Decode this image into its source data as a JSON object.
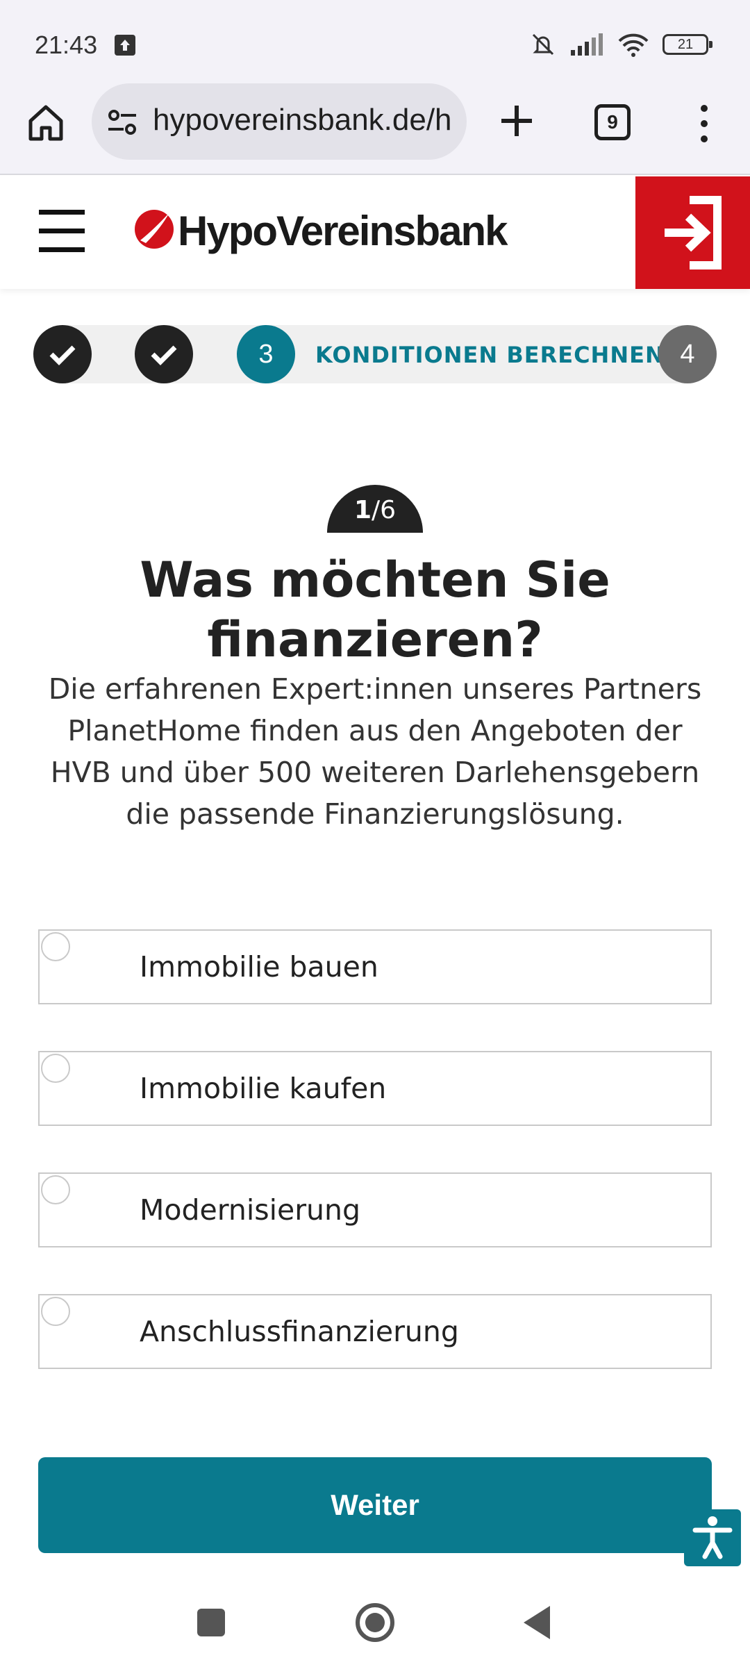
{
  "status_bar": {
    "time": "21:43",
    "battery": "21",
    "icons": [
      "upload-icon",
      "mute-icon",
      "signal-icon",
      "wifi-icon",
      "battery-icon"
    ]
  },
  "browser": {
    "url": "hypovereinsbank.de/h",
    "tab_count": "9"
  },
  "header": {
    "brand": "HypoVereinsbank",
    "brand_color": "#d1121b"
  },
  "stepper": {
    "steps": [
      {
        "state": "done"
      },
      {
        "state": "done"
      },
      {
        "number": "3",
        "state": "active",
        "label": "KONDITIONEN BERECHNEN"
      },
      {
        "number": "4",
        "state": "future"
      }
    ],
    "accent_color": "#0a7a8e"
  },
  "question": {
    "counter_current": "1",
    "counter_total": "/6",
    "title": "Was möchten Sie finanzieren?",
    "description": "Die erfahrenen Expert:innen unseres Partners PlanetHome finden aus den Angeboten der HVB und über 500 weiteren Darlehensgebern die passende Finanzierungslösung."
  },
  "options": [
    {
      "label": "Immobilie bauen",
      "selected": false
    },
    {
      "label": "Immobilie kaufen",
      "selected": false
    },
    {
      "label": "Modernisierung",
      "selected": false
    },
    {
      "label": "Anschlussfinanzierung",
      "selected": false
    }
  ],
  "submit": {
    "label": "Weiter"
  }
}
